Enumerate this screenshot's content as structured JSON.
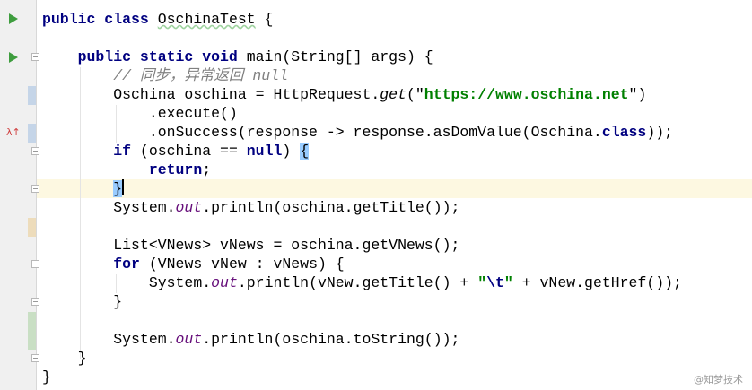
{
  "editor": {
    "lines": [
      [
        [
          "public class ",
          "kw"
        ],
        [
          "OschinaTest",
          "wavy"
        ],
        [
          " {",
          ""
        ]
      ],
      [],
      [
        [
          "    public static void ",
          "kw"
        ],
        [
          "main(String[] args) {",
          ""
        ]
      ],
      [
        [
          "        // 同步，异常返回 null",
          "cm"
        ]
      ],
      [
        [
          "        Oschina oschina = HttpRequest.",
          ""
        ],
        [
          "get",
          "it"
        ],
        [
          "(\"",
          ""
        ],
        [
          "https://www.oschina.net",
          "url"
        ],
        [
          "\")",
          ""
        ]
      ],
      [
        [
          "            .execute()",
          ""
        ]
      ],
      [
        [
          "            .onSuccess(response -> response.asDomValue(Oschina.",
          ""
        ],
        [
          "class",
          "kw"
        ],
        [
          "));",
          ""
        ]
      ],
      [
        [
          "        ",
          ""
        ],
        [
          "if",
          "kw"
        ],
        [
          " (oschina == ",
          ""
        ],
        [
          "null",
          "kw"
        ],
        [
          ") ",
          ""
        ],
        [
          "{",
          "brace"
        ]
      ],
      [
        [
          "            ",
          ""
        ],
        [
          "return",
          "kw"
        ],
        [
          ";",
          ""
        ]
      ],
      [
        [
          "        ",
          ""
        ],
        [
          "}",
          "brace"
        ],
        [
          "",
          "caret"
        ]
      ],
      [
        [
          "        System.",
          ""
        ],
        [
          "out",
          "fld"
        ],
        [
          ".println(oschina.getTitle());",
          ""
        ]
      ],
      [],
      [
        [
          "        List<VNews> vNews = oschina.getVNews();",
          ""
        ]
      ],
      [
        [
          "        ",
          ""
        ],
        [
          "for",
          "kw"
        ],
        [
          " (VNews vNew : vNews) {",
          ""
        ]
      ],
      [
        [
          "            System.",
          ""
        ],
        [
          "out",
          "fld"
        ],
        [
          ".println(vNew.getTitle() + ",
          ""
        ],
        [
          "\"",
          "str"
        ],
        [
          "\\t",
          "kw"
        ],
        [
          "\"",
          "str"
        ],
        [
          " + vNew.getHref());",
          ""
        ]
      ],
      [
        [
          "        }",
          ""
        ]
      ],
      [],
      [
        [
          "        System.",
          ""
        ],
        [
          "out",
          "fld"
        ],
        [
          ".println(oschina.toString());",
          ""
        ]
      ],
      [
        [
          "    }",
          ""
        ]
      ],
      [
        [
          "}",
          ""
        ]
      ]
    ]
  },
  "gutter": {
    "lambda_marker": "λ↑"
  },
  "watermark": "@知梦技术",
  "colors": {
    "keyword": "#000080",
    "string": "#008000",
    "comment": "#808080",
    "field": "#660e7a",
    "current_line": "#fdf8e1"
  }
}
